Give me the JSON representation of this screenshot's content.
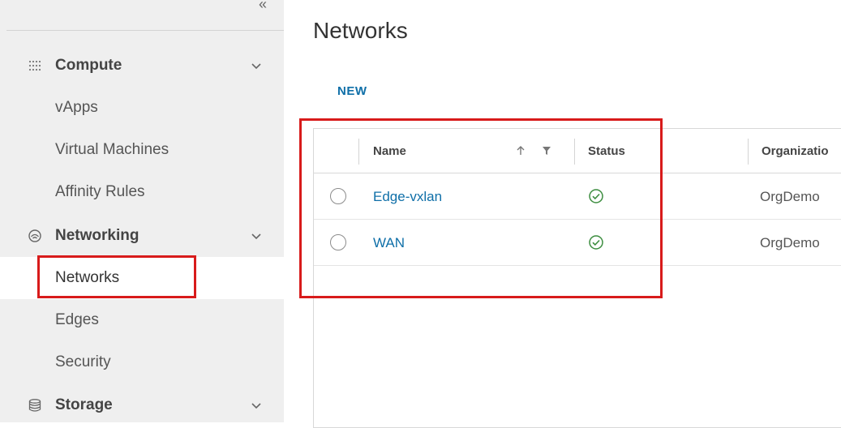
{
  "sidebar": {
    "groups": {
      "compute": {
        "label": "Compute",
        "items": [
          "vApps",
          "Virtual Machines",
          "Affinity Rules"
        ]
      },
      "networking": {
        "label": "Networking",
        "items": [
          "Networks",
          "Edges",
          "Security"
        ]
      },
      "storage": {
        "label": "Storage"
      }
    },
    "active_item": "Networks"
  },
  "main": {
    "title": "Networks",
    "new_label": "NEW",
    "columns": {
      "name": "Name",
      "status": "Status",
      "organization": "Organizatio"
    },
    "rows": [
      {
        "name": "Edge-vxlan",
        "status": "ok",
        "organization": "OrgDemo"
      },
      {
        "name": "WAN",
        "status": "ok",
        "organization": "OrgDemo"
      }
    ]
  },
  "colors": {
    "link": "#0f6fa8",
    "status_ok": "#3c8d3f",
    "highlight": "#d81b1b",
    "sidebar_bg": "#efefef"
  },
  "icons": {
    "collapse": "double-chevron-left-icon",
    "compute": "grid-dots-icon",
    "networking": "network-icon",
    "storage": "database-icon",
    "expand": "chevron-down-icon",
    "sort": "arrow-up-icon",
    "filter": "filter-icon",
    "status": "check-circle-icon"
  }
}
